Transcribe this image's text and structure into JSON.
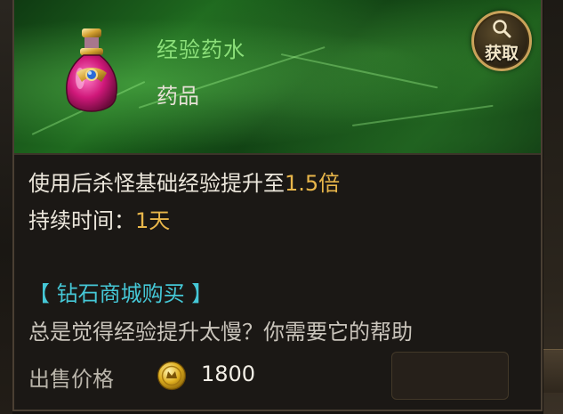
{
  "item": {
    "name": "经验药水",
    "type": "药品",
    "effect_prefix": "使用后杀怪基础经验提升至",
    "effect_value": "1.5倍",
    "duration_label": "持续时间：",
    "duration_value": "1天",
    "shop_source": "【 钻石商城购买 】",
    "description": "总是觉得经验提升太慢？你需要它的帮助",
    "price_label": "出售价格",
    "price_value": "1800"
  },
  "buttons": {
    "get_label": "获取"
  },
  "colors": {
    "name": "#8ce07a",
    "highlight": "#e8b64a",
    "shop": "#45c7d6",
    "header_green": "#1f6a1f"
  },
  "icons": {
    "item": "potion-icon",
    "get": "magnifier-icon",
    "currency": "gold-coin-icon"
  }
}
